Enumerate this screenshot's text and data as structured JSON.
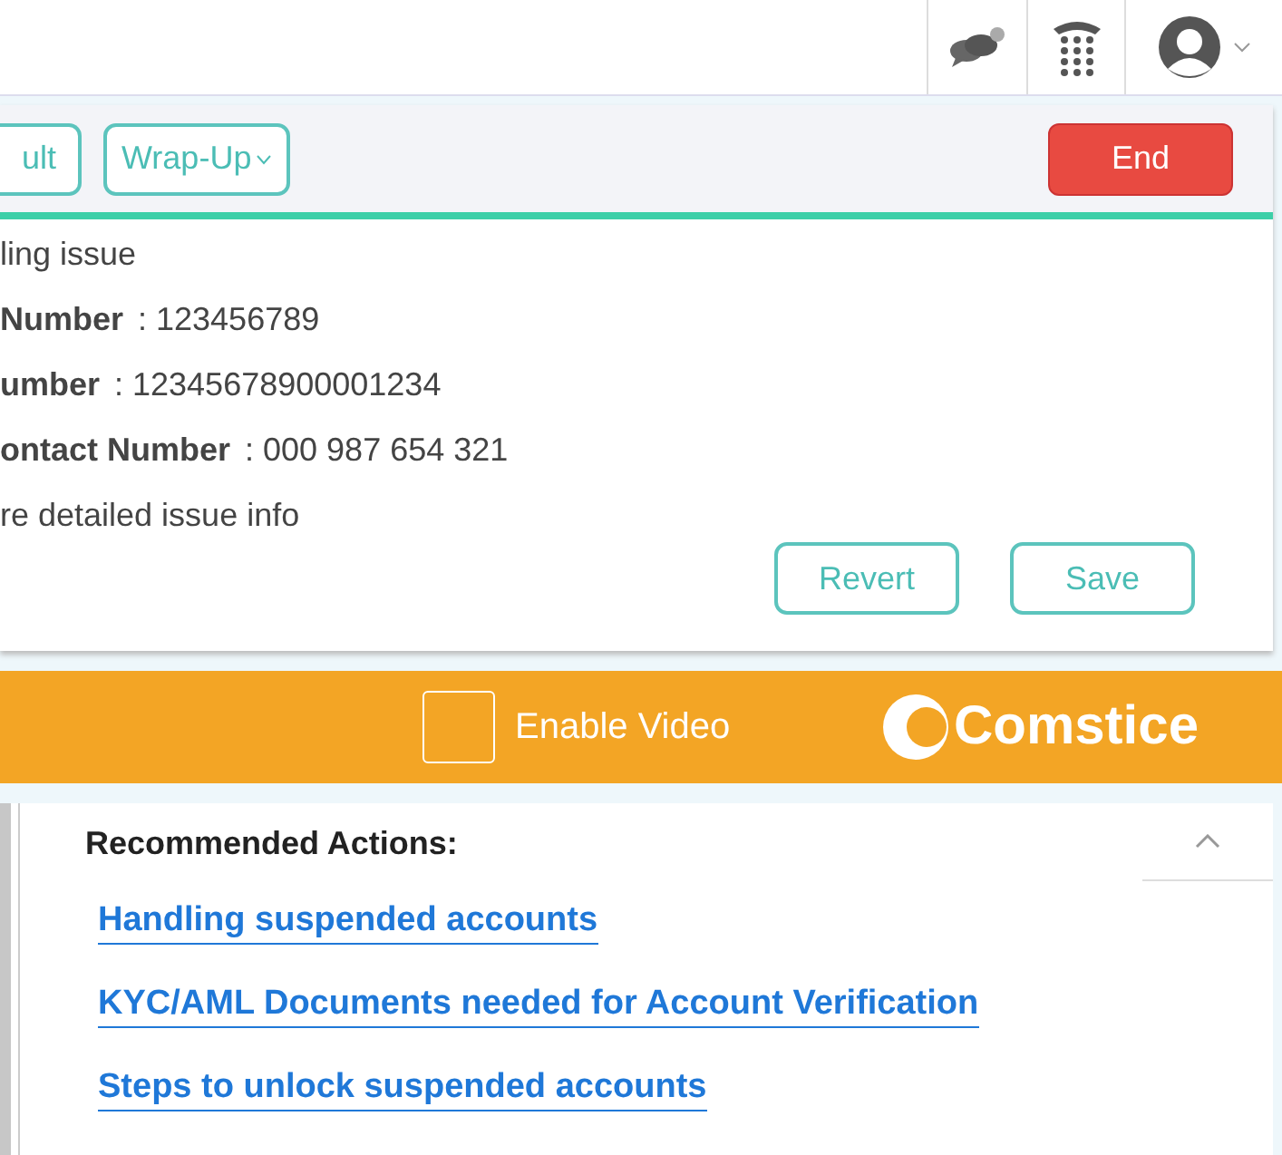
{
  "toolbar": {
    "buttons": [
      {
        "label": "ult",
        "kind": "plain"
      },
      {
        "label": "Wrap-Up",
        "kind": "dropdown"
      }
    ],
    "end_button": "End"
  },
  "details": {
    "summary": "ling issue",
    "fields": [
      {
        "label": "Number",
        "value": ": 123456789"
      },
      {
        "label": "umber",
        "value": ": 12345678900001234"
      },
      {
        "label": "ontact Number",
        "value": ": 000 987 654 321"
      }
    ],
    "note": "re detailed issue info",
    "buttons": [
      "Revert",
      "Save"
    ]
  },
  "video_bar": {
    "enable_video": {
      "label": "Enable Video",
      "checked": false
    },
    "brand": "Comstice"
  },
  "recommended": {
    "title": "Recommended Actions:",
    "expanded": true,
    "links": [
      "Handling suspended accounts",
      "KYC/AML Documents needed for Account Verification",
      "Steps to unlock suspended accounts"
    ]
  }
}
